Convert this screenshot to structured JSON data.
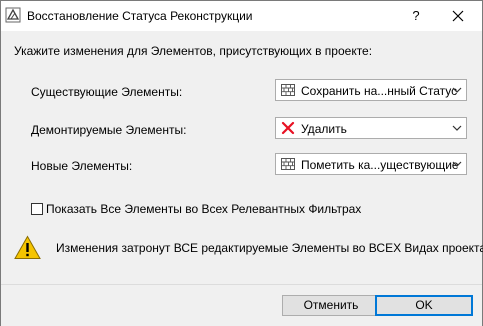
{
  "window": {
    "title": "Восстановление Статуса Реконструкции",
    "help_label": "?"
  },
  "instruction": "Укажите изменения для Элементов, присутствующих в проекте:",
  "rows": [
    {
      "label": "Существующие Элементы:",
      "selected": "Сохранить на...нный Статус",
      "icon": "brick-wall-icon"
    },
    {
      "label": "Демонтируемые Элементы:",
      "selected": "Удалить",
      "icon": "red-x-icon"
    },
    {
      "label": "Новые Элементы:",
      "selected": "Пометить ка...уществующие",
      "icon": "brick-wall-icon"
    }
  ],
  "checkbox": {
    "label": "Показать Все Элементы во Всех Релевантных Фильтрах",
    "checked": false
  },
  "warning": {
    "text": "Изменения затронут ВСЕ редактируемые Элементы во ВСЕХ Видах проекта!",
    "icon": "warning-triangle-icon"
  },
  "buttons": {
    "cancel": "Отменить",
    "ok": "OK"
  },
  "colors": {
    "accent": "#0078d7",
    "dialog_bg": "#f0f0f0",
    "delete_x": "#e81123",
    "warning_yellow": "#f5c400"
  }
}
